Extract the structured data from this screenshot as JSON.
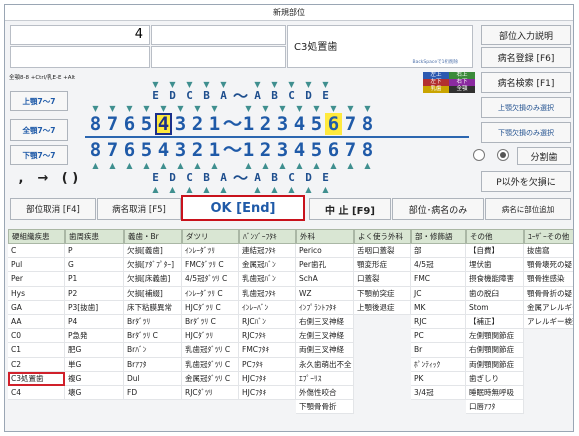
{
  "window": {
    "title": "新規部位"
  },
  "top": {
    "number_field": "4",
    "code_label": "C3処置歯",
    "backspace_hint": "BackSpaceで1桁削除"
  },
  "right_buttons": {
    "part_input": "部位入力説明",
    "disease_register": "病名登録 [F6]",
    "disease_search": "病名検索 [F1]",
    "upper_missing": "上顎欠損のみ選択",
    "lower_missing": "下顎欠損のみ選択",
    "split_tooth": "分割歯",
    "excl_p": "P以外を欠損に"
  },
  "keyhint": "全顎8-8 +Ctrl/乳E-E +Alt",
  "legend": [
    "左上",
    "右上",
    "左下",
    "右下",
    "乳歯",
    "全顎"
  ],
  "jaw": {
    "upper": "上顎7～7",
    "full": "全顎7～7",
    "lower": "下顎7～7"
  },
  "teeth": {
    "upper_primary": [
      "E",
      "D",
      "C",
      "B",
      "A",
      "～",
      "A",
      "B",
      "C",
      "D",
      "E"
    ],
    "upper_perm": [
      "8",
      "7",
      "6",
      "5",
      "4",
      "3",
      "2",
      "1",
      "～",
      "1",
      "2",
      "3",
      "4",
      "5",
      "6",
      "7",
      "8"
    ],
    "lower_perm": [
      "8",
      "7",
      "6",
      "5",
      "4",
      "3",
      "2",
      "1",
      "～",
      "1",
      "2",
      "3",
      "4",
      "5",
      "6",
      "7",
      "8"
    ],
    "lower_primary": [
      "E",
      "D",
      "C",
      "B",
      "A",
      "～",
      "A",
      "B",
      "C",
      "D",
      "E"
    ],
    "selected_right": "4",
    "highlight_left": "6"
  },
  "symbols": {
    "comma": ",",
    "arrow": "→",
    "parens": "( )"
  },
  "actions": {
    "cancel_part": "部位取消 [F4]",
    "cancel_disease": "病名取消 [F5]",
    "ok": "OK [End]",
    "stop": "中 止 [F9]",
    "part_disease_only": "部位･病名のみ",
    "add_to_disease": "病名に部位追加"
  },
  "columns": [
    {
      "header": "硬組織疾患",
      "items": [
        "C",
        "Pul",
        "Per",
        "Hys",
        "GA",
        "AA",
        "C0",
        "C1",
        "C2",
        "C3処置歯",
        "C4"
      ]
    },
    {
      "header": "歯周疾患",
      "items": [
        "P",
        "G",
        "P1",
        "P2",
        "P3[抜歯]",
        "P4",
        "P急発",
        "肥G",
        "単G",
        "複G",
        "壊G"
      ]
    },
    {
      "header": "義歯・Br",
      "items": [
        "欠損[義歯]",
        "欠損[ｱﾀﾞﾌﾟﾀｰ]",
        "欠損[床義歯]",
        "欠損[補綴]",
        "床下粘膜異常",
        "Brﾀﾞﾂﾘ",
        "Brﾀﾞﾂﾘ C",
        "Brﾊﾞﾝ",
        "Brｱﾌﾀ",
        "Dul",
        "FD"
      ]
    },
    {
      "header": "ダツリ",
      "items": [
        "ｲﾝﾚｰﾀﾞﾂﾘ",
        "FMCﾀﾞﾂﾘ C",
        "4/5冠ﾀﾞﾂﾘ C",
        "ｲﾝﾚｰﾀﾞﾂﾘ C",
        "HJCﾀﾞﾂﾘ C",
        "Brﾀﾞﾂﾘ C",
        "HJCﾀﾞﾂﾘ",
        "乳歯冠ﾀﾞﾂﾘ C",
        "乳歯冠ﾀﾞﾂﾘ C",
        "金属冠ﾀﾞﾂﾘ C",
        "RJCﾀﾞﾂﾘ"
      ]
    },
    {
      "header": "ﾊﾞﾝｿﾞｰﾌﾀｷ",
      "items": [
        "連結冠ﾌﾀｷ",
        "金属冠ﾊﾞﾝ",
        "乳歯冠ﾊﾞﾝ",
        "乳歯冠ﾌﾀｷ",
        "ｲﾝﾚｰﾊﾞﾝ",
        "RJCﾊﾞﾝ",
        "RJCﾌﾀｷ",
        "FMCﾌﾀｷ",
        "PCﾌﾀｷ",
        "HJCﾌﾀｷ",
        "HJCﾌﾀｷ"
      ]
    },
    {
      "header": "外科",
      "items": [
        "Perico",
        "Per歯孔",
        "SchA",
        "WZ",
        "ｲﾝﾌﾟﾗﾝﾄﾌﾀｷ",
        "右側三叉神経",
        "左側三叉神経",
        "両側三叉神経",
        "永久歯萌出不全",
        "ｴﾌﾟｰﾘｽ",
        "外傷性咬合",
        "下顎骨骨折"
      ]
    },
    {
      "header": "よく使う外科",
      "items": [
        "舌咽口蓋裂",
        "顎変形症",
        "口蓋裂",
        "下顎前突症",
        "上顎後退症"
      ]
    },
    {
      "header": "部・修飾語",
      "items": [
        "部",
        "4/5冠",
        "FMC",
        "JC",
        "MK",
        "RJC",
        "PC",
        "Br",
        "ﾎﾟﾝﾃｨｯｸ",
        "PK",
        "3/4冠"
      ]
    },
    {
      "header": "その他",
      "items": [
        "【自費】",
        "埋伏歯",
        "摂食機能障害",
        "歯の脱臼",
        "Stom",
        "【補正】",
        "左側顎関節症",
        "右側顎関節症",
        "両側顎関節症",
        "歯ぎしり",
        "睡眠時無呼吸",
        "口唇ｱﾌﾀ"
      ]
    },
    {
      "header": "ﾕｰｻﾞｰその他",
      "items": [
        "抜歯窩",
        "顎骨壊死の疑い",
        "顎骨挫感染",
        "顎骨骨折の疑い",
        "金属アレルギー",
        "アレルギー検査"
      ]
    }
  ]
}
